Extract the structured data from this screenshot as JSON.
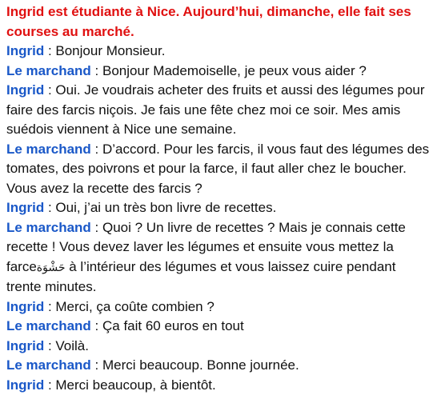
{
  "title": "Ingrid est étudiante à Nice. Aujourd’hui, dimanche, elle fait ses courses au marché.",
  "separator": " : ",
  "dialogue": [
    {
      "speaker": "Ingrid",
      "text": "Bonjour Monsieur."
    },
    {
      "speaker": "Le marchand",
      "text": "Bonjour Mademoiselle, je peux vous aider ?"
    },
    {
      "speaker": "Ingrid",
      "text": "Oui. Je voudrais acheter des fruits et aussi des légumes pour faire des farcis niçois. Je fais une fête chez moi ce soir. Mes amis suédois viennent à Nice une semaine."
    },
    {
      "speaker": "Le marchand",
      "text": "D’accord. Pour les farcis, il vous faut des légumes des tomates, des poivrons et pour la farce, il faut aller chez le boucher. Vous avez la recette des farcis ?"
    },
    {
      "speaker": "Ingrid",
      "text": "Oui, j’ai un très bon livre de recettes."
    },
    {
      "speaker": "Le marchand",
      "text_before": "Quoi ? Un livre de recettes ? Mais je connais cette recette ! Vous devez laver les légumes et ensuite vous mettez la farce",
      "annotation": "حَشْوَة",
      "text_after": " à l’intérieur des légumes et vous laissez cuire pendant trente minutes."
    },
    {
      "speaker": "Ingrid",
      "text": "Merci, ça coûte combien ?"
    },
    {
      "speaker": "Le marchand",
      "text": "Ça fait 60 euros en tout"
    },
    {
      "speaker": "Ingrid",
      "text": "Voilà."
    },
    {
      "speaker": "Le marchand",
      "text": "Merci beaucoup. Bonne journée."
    },
    {
      "speaker": "Ingrid",
      "text": "Merci beaucoup, à bientôt."
    }
  ]
}
